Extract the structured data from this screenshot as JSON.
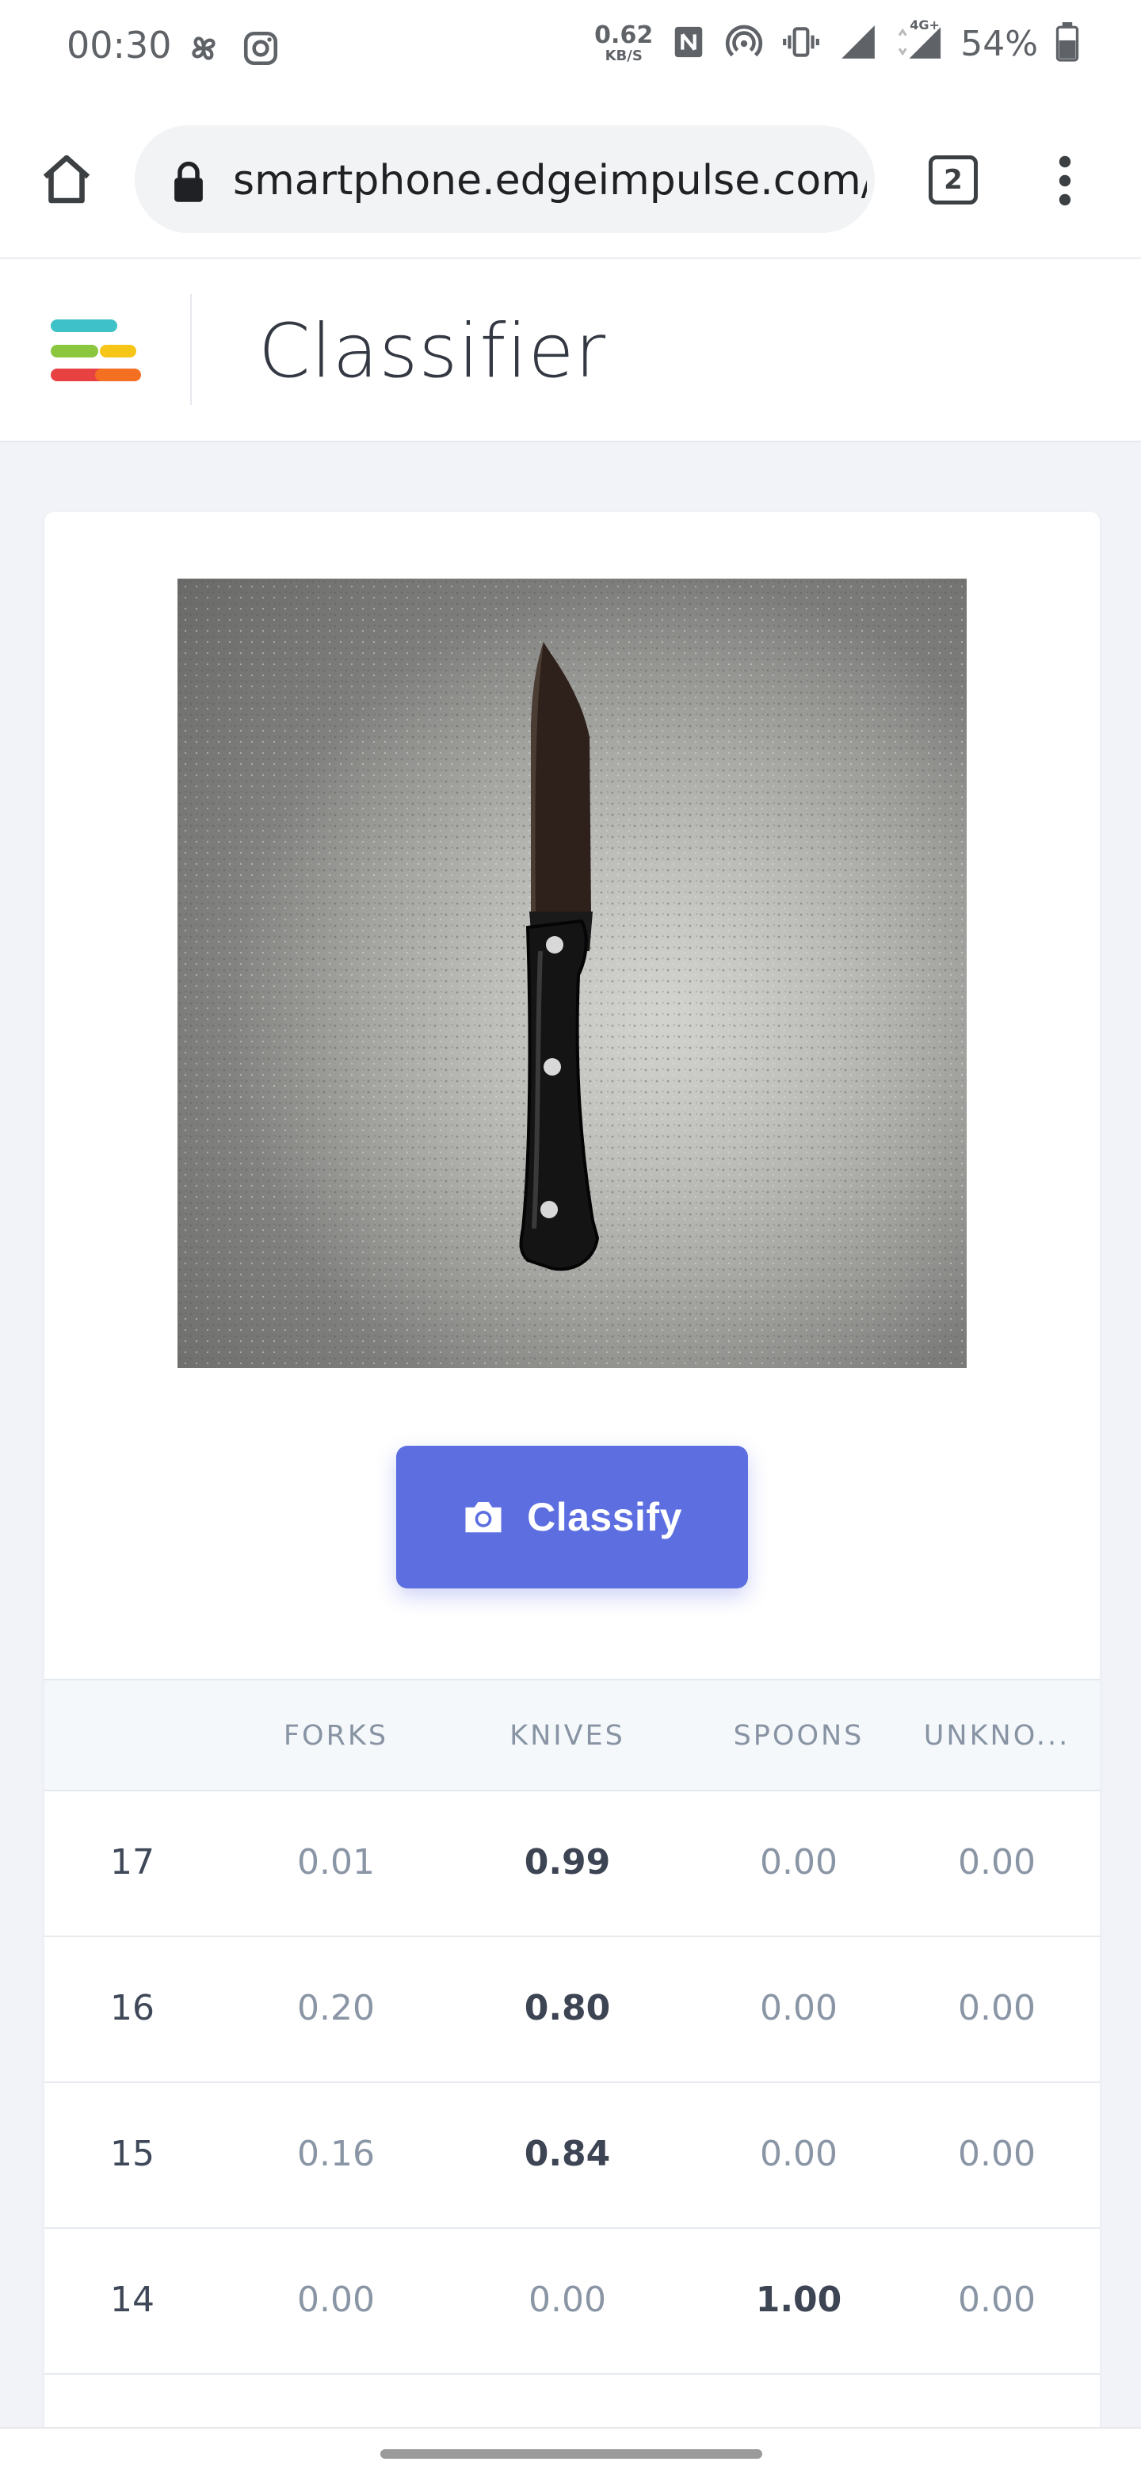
{
  "status_bar": {
    "time": "00:30",
    "net_speed_value": "0.62",
    "net_speed_unit": "KB/S",
    "network_type": "4G+",
    "battery": "54%"
  },
  "browser": {
    "url": "smartphone.edgeimpulse.com/",
    "tab_count": "2"
  },
  "header": {
    "title": "Classifier",
    "logo_colors": [
      "#3fc1c9",
      "#8ac73f",
      "#f5c518",
      "#f36f21",
      "#e84142"
    ]
  },
  "capture": {
    "image_subject": "knife-on-gray-countertop"
  },
  "classify_button": {
    "label": "Classify",
    "color": "#5c6ee0"
  },
  "results": {
    "columns": [
      "FORKS",
      "KNIVES",
      "SPOONS",
      "UNKNO..."
    ],
    "rows": [
      {
        "index": "17",
        "values": [
          "0.01",
          "0.99",
          "0.00",
          "0.00"
        ],
        "best": 1
      },
      {
        "index": "16",
        "values": [
          "0.20",
          "0.80",
          "0.00",
          "0.00"
        ],
        "best": 1
      },
      {
        "index": "15",
        "values": [
          "0.16",
          "0.84",
          "0.00",
          "0.00"
        ],
        "best": 1
      },
      {
        "index": "14",
        "values": [
          "0.00",
          "0.00",
          "1.00",
          "0.00"
        ],
        "best": 2
      }
    ]
  }
}
